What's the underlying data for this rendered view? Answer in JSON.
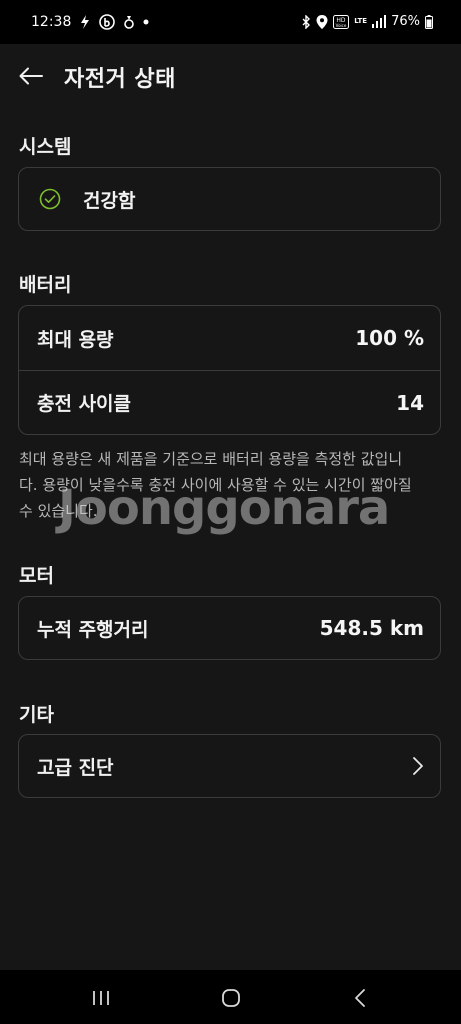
{
  "status_bar": {
    "time": "12:38",
    "battery_percent": "76%",
    "network": "LTE"
  },
  "header": {
    "title": "자전거 상태"
  },
  "system": {
    "section_title": "시스템",
    "status_text": "건강함"
  },
  "battery": {
    "section_title": "배터리",
    "rows": [
      {
        "label": "최대 용량",
        "value": "100 %"
      },
      {
        "label": "충전 사이클",
        "value": "14"
      }
    ],
    "note": "최대 용량은 새 제품을 기준으로 배터리 용량을 측정한 값입니다. 용량이 낮을수록 충전 사이에 사용할 수 있는 시간이 짧아질 수 있습니다."
  },
  "motor": {
    "section_title": "모터",
    "rows": [
      {
        "label": "누적 주행거리",
        "value": "548.5 km"
      }
    ]
  },
  "other": {
    "section_title": "기타",
    "rows": [
      {
        "label": "고급 진단"
      }
    ]
  },
  "watermark": "Joonggonara",
  "colors": {
    "background": "#161616",
    "card_border": "#3b3b3b",
    "healthy_accent": "#7fbf2f"
  }
}
